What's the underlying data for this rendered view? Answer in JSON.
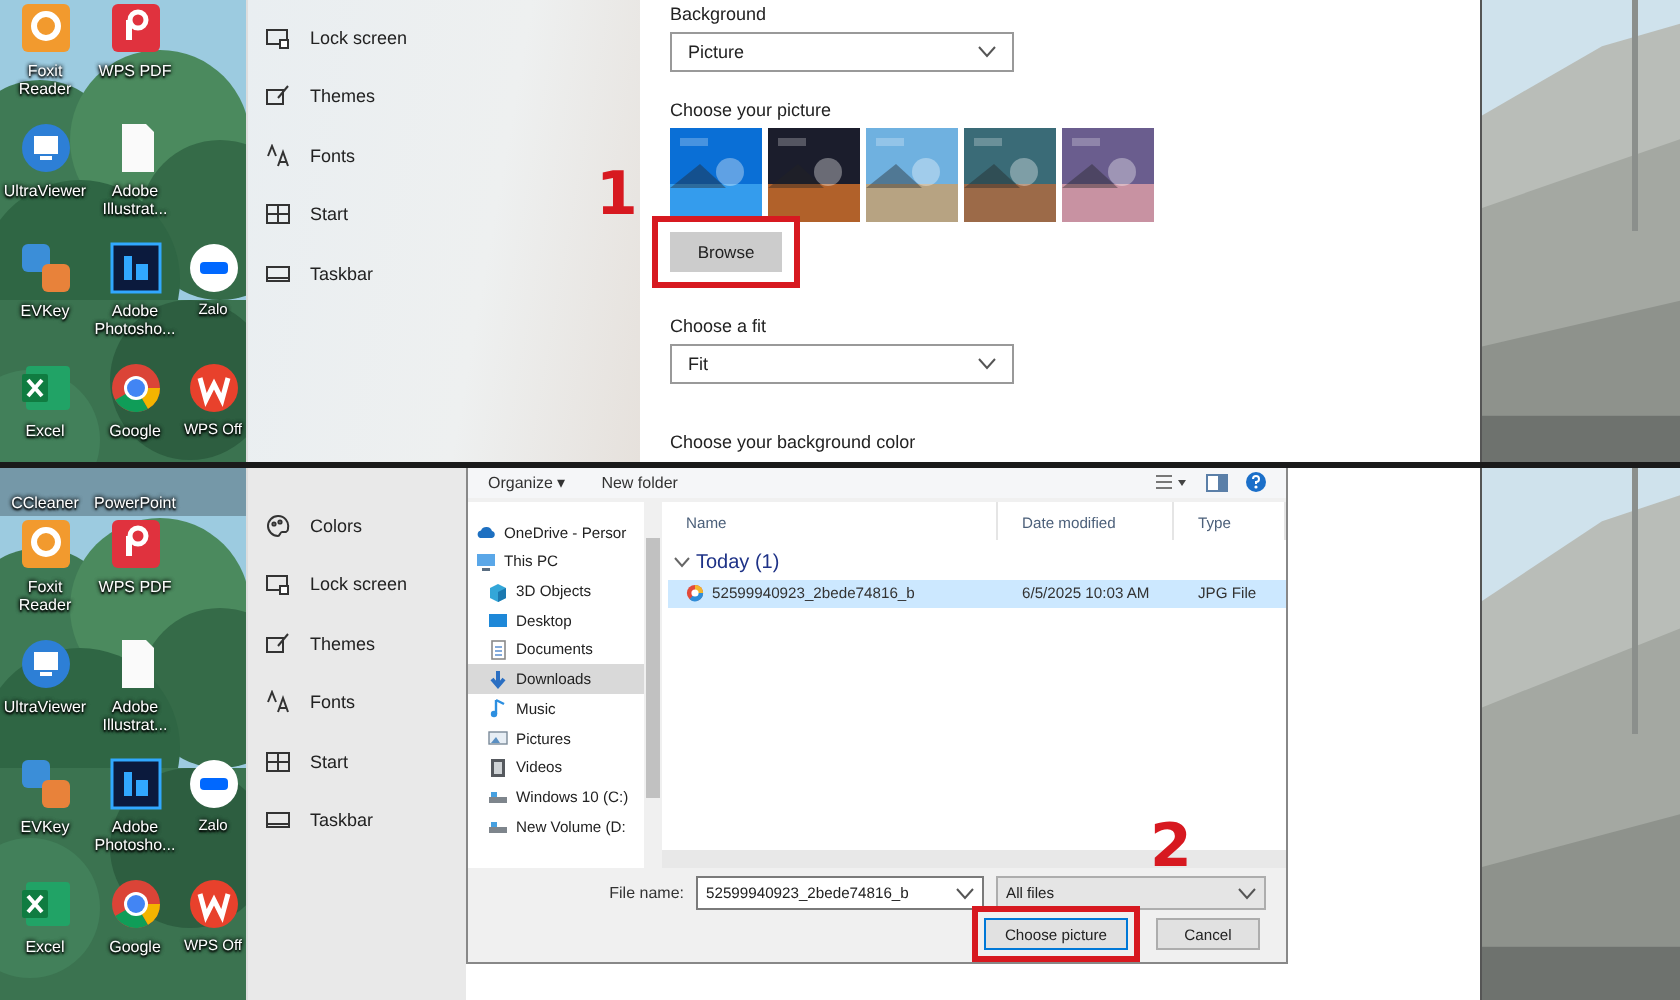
{
  "top_panel": {
    "step_number": "1",
    "desktop_rows": [
      [
        {
          "label": "Foxit Reader",
          "kind": "foxit"
        },
        {
          "label": "WPS PDF",
          "kind": "wpspdf"
        }
      ],
      [
        {
          "label": "UltraViewer",
          "kind": "ultraviewer"
        },
        {
          "label": "Adobe Illustrat...",
          "kind": "file"
        }
      ],
      [
        {
          "label": "EVKey",
          "kind": "evkey"
        },
        {
          "label": "Adobe Photosho...",
          "kind": "photoshop"
        },
        {
          "label": "Zalo",
          "kind": "zalo"
        }
      ],
      [
        {
          "label": "Excel",
          "kind": "excel"
        },
        {
          "label": "Google",
          "kind": "chrome"
        },
        {
          "label": "WPS Off",
          "kind": "wps"
        }
      ]
    ],
    "nav": [
      {
        "label": "Lock screen",
        "kind": "lock"
      },
      {
        "label": "Themes",
        "kind": "themes"
      },
      {
        "label": "Fonts",
        "kind": "fonts"
      },
      {
        "label": "Start",
        "kind": "start"
      },
      {
        "label": "Taskbar",
        "kind": "taskbar"
      }
    ],
    "background_label": "Background",
    "background_value": "Picture",
    "picture_label": "Choose your picture",
    "thumbnails": [
      {
        "kind": "picture"
      },
      {
        "kind": "picture"
      },
      {
        "kind": "picture"
      },
      {
        "kind": "picture"
      },
      {
        "kind": "picture"
      }
    ],
    "browse_button": "Browse",
    "fit_label": "Choose a fit",
    "fit_value": "Fit",
    "color_label": "Choose your background color"
  },
  "bottom_panel": {
    "step_number": "2",
    "desktop_cut_labels": [
      "CCleaner",
      "PowerPoint"
    ],
    "desktop_rows": [
      [
        {
          "label": "Foxit Reader",
          "kind": "foxit"
        },
        {
          "label": "WPS PDF",
          "kind": "wpspdf"
        }
      ],
      [
        {
          "label": "UltraViewer",
          "kind": "ultraviewer"
        },
        {
          "label": "Adobe Illustrat...",
          "kind": "file"
        }
      ],
      [
        {
          "label": "EVKey",
          "kind": "evkey"
        },
        {
          "label": "Adobe Photosho...",
          "kind": "photoshop"
        },
        {
          "label": "Zalo",
          "kind": "zalo"
        }
      ],
      [
        {
          "label": "Excel",
          "kind": "excel"
        },
        {
          "label": "Google",
          "kind": "chrome"
        },
        {
          "label": "WPS Off",
          "kind": "wps"
        }
      ]
    ],
    "nav": [
      {
        "label": "Colors",
        "kind": "colors"
      },
      {
        "label": "Lock screen",
        "kind": "lock"
      },
      {
        "label": "Themes",
        "kind": "themes"
      },
      {
        "label": "Fonts",
        "kind": "fonts"
      },
      {
        "label": "Start",
        "kind": "start"
      },
      {
        "label": "Taskbar",
        "kind": "taskbar"
      }
    ],
    "dialog": {
      "toolbar": [
        "Organize ▾",
        "New folder"
      ],
      "tree": [
        {
          "label": "OneDrive - Persor",
          "kind": "cloud",
          "selected": false
        },
        {
          "label": "This PC",
          "kind": "pc",
          "selected": false,
          "children": [
            {
              "label": "3D Objects",
              "kind": "cube",
              "selected": false
            },
            {
              "label": "Desktop",
              "kind": "desktop",
              "selected": false
            },
            {
              "label": "Documents",
              "kind": "document",
              "selected": false
            },
            {
              "label": "Downloads",
              "kind": "download",
              "selected": true
            },
            {
              "label": "Music",
              "kind": "music",
              "selected": false
            },
            {
              "label": "Pictures",
              "kind": "pictures",
              "selected": false
            },
            {
              "label": "Videos",
              "kind": "videos",
              "selected": false
            },
            {
              "label": "Windows 10 (C:)",
              "kind": "drive",
              "selected": false
            },
            {
              "label": "New Volume (D:",
              "kind": "drive",
              "selected": false
            }
          ]
        }
      ],
      "columns": [
        "Name",
        "Date modified",
        "Type"
      ],
      "group": {
        "label": "Today (1)",
        "expanded": true
      },
      "files": [
        {
          "name": "52599940923_2bede74816_b",
          "date": "6/5/2025 10:03 AM",
          "type": "JPG File",
          "selected": true
        }
      ],
      "file_name_label": "File name:",
      "file_name_value": "52599940923_2bede74816_b",
      "filter": "All files",
      "buttons": [
        {
          "label": "Choose picture",
          "highlighted": true
        },
        {
          "label": "Cancel",
          "highlighted": false
        }
      ]
    }
  }
}
